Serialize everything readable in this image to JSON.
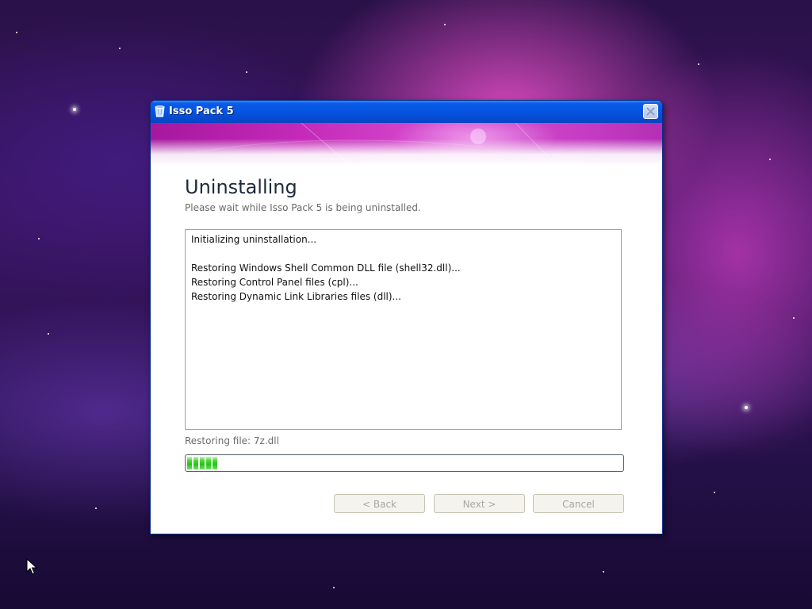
{
  "window": {
    "title": "Isso Pack 5",
    "heading": "Uninstalling",
    "subheading": "Please wait while Isso Pack 5 is being uninstalled.",
    "log_lines": [
      "Initializing uninstallation...",
      "",
      "Restoring Windows Shell Common DLL file (shell32.dll)...",
      "Restoring Control Panel files (cpl)...",
      "Restoring Dynamic Link Libraries files (dll)..."
    ],
    "status": "Restoring file: 7z.dll",
    "progress_percent": 8,
    "buttons": {
      "back": "< Back",
      "next": "Next >",
      "cancel": "Cancel"
    }
  },
  "icons": {
    "app": "recycle-bin-icon",
    "close": "close-icon",
    "cursor": "mouse-pointer-icon"
  },
  "colors": {
    "titlebar": "#0552e0",
    "banner": "#c52ab9",
    "progress": "#2ac01c"
  }
}
